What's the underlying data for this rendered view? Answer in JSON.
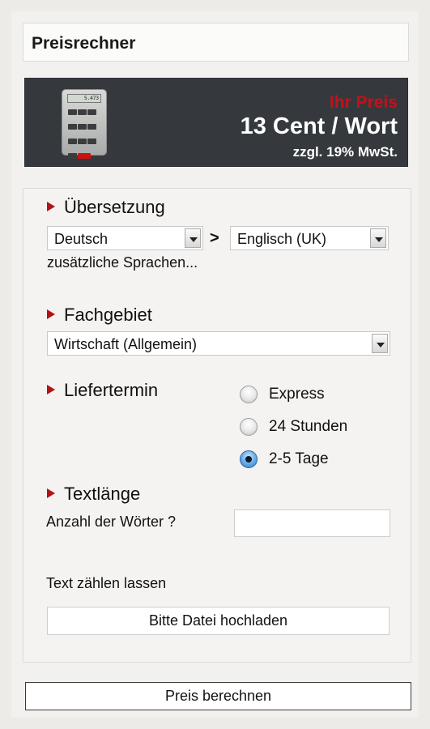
{
  "header": {
    "title": "Preisrechner"
  },
  "price": {
    "label": "Ihr Preis",
    "value": "13 Cent / Wort",
    "tax_note": "zzgl. 19% MwSt.",
    "calculator_display": "5.473"
  },
  "translation": {
    "heading": "Übersetzung",
    "source_language": "Deutsch",
    "separator": ">",
    "target_language": "Englisch (UK)",
    "more_languages_link": "zusätzliche Sprachen..."
  },
  "subject": {
    "heading": "Fachgebiet",
    "selected": "Wirtschaft (Allgemein)"
  },
  "delivery": {
    "heading": "Liefertermin",
    "options": [
      {
        "label": "Express",
        "checked": false
      },
      {
        "label": "24 Stunden",
        "checked": false
      },
      {
        "label": "2-5 Tage",
        "checked": true
      }
    ]
  },
  "text_length": {
    "heading": "Textlänge",
    "word_count_label": "Anzahl der Wörter ?",
    "word_count_value": "",
    "count_text_label": "Text zählen lassen",
    "upload_button": "Bitte Datei hochladen"
  },
  "calculate_button": "Preis berechnen",
  "colors": {
    "accent_red": "#b01318",
    "price_box_bg": "#35393e",
    "radio_selected": "#2c78c4"
  }
}
